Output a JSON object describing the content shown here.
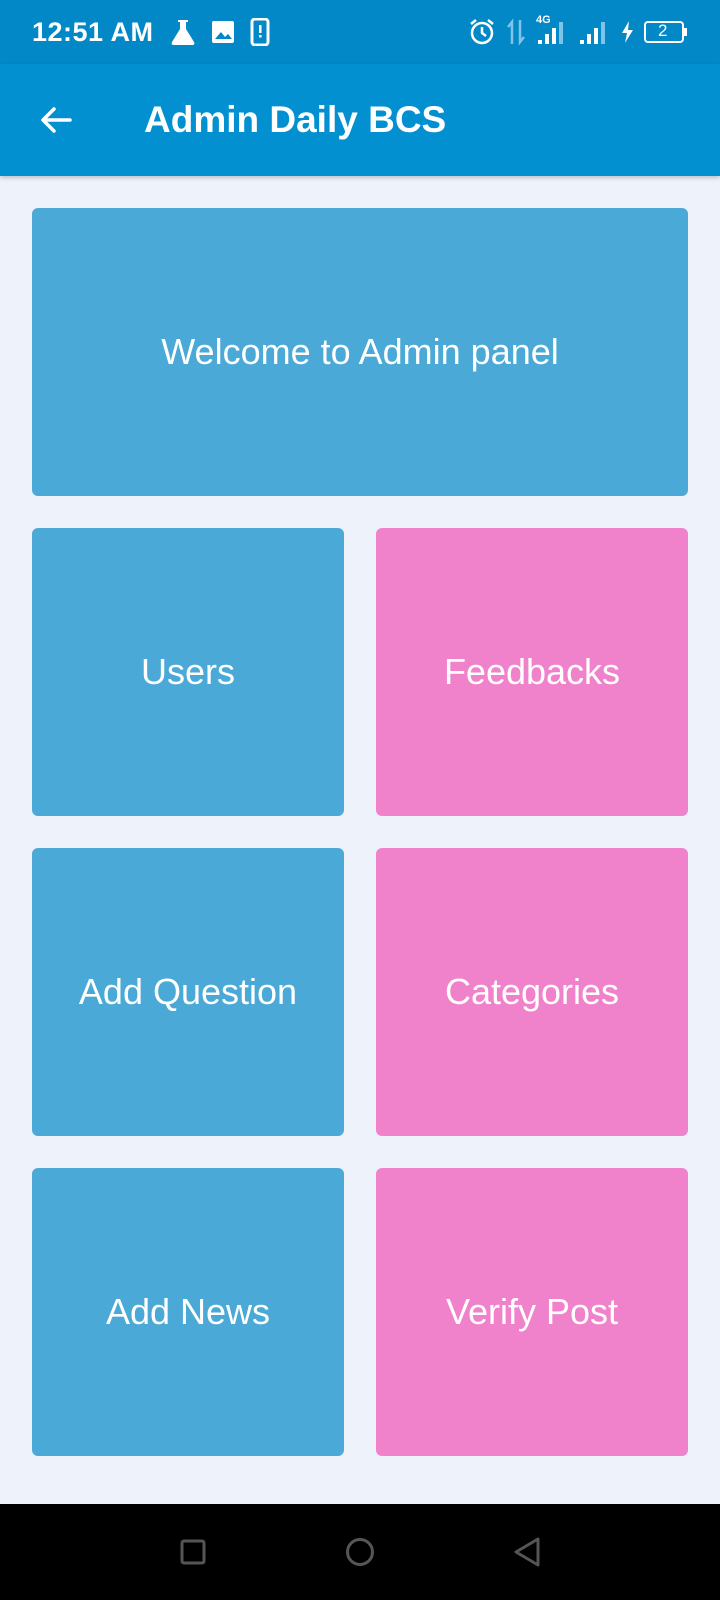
{
  "status_bar": {
    "time": "12:51 AM",
    "left_icons": [
      "flask-icon",
      "image-icon",
      "phone-alert-icon"
    ],
    "right_icons": [
      "alarm-icon",
      "data-arrows-icon",
      "signal-4g-icon",
      "signal-icon",
      "charging-icon",
      "battery-icon"
    ],
    "network_label": "4G",
    "battery_level": "2"
  },
  "app_bar": {
    "back_icon": "arrow-left-icon",
    "title": "Admin Daily BCS"
  },
  "welcome": {
    "label": "Welcome to Admin panel"
  },
  "tiles": [
    {
      "label": "Users",
      "color": "#4AA9D6"
    },
    {
      "label": "Feedbacks",
      "color": "#F082CC"
    },
    {
      "label": "Add Question",
      "color": "#4AA9D6"
    },
    {
      "label": "Categories",
      "color": "#F082CC"
    },
    {
      "label": "Add News",
      "color": "#4AA9D6"
    },
    {
      "label": "Verify Post",
      "color": "#F082CC"
    }
  ],
  "nav_bar": {
    "icons": [
      "recents-square-icon",
      "home-circle-icon",
      "back-triangle-icon"
    ]
  },
  "colors": {
    "status_bar": "#0288C7",
    "app_bar": "#0290D1",
    "background": "#EEF2FB",
    "blue_tile": "#4AA9D6",
    "pink_tile": "#F082CC"
  }
}
